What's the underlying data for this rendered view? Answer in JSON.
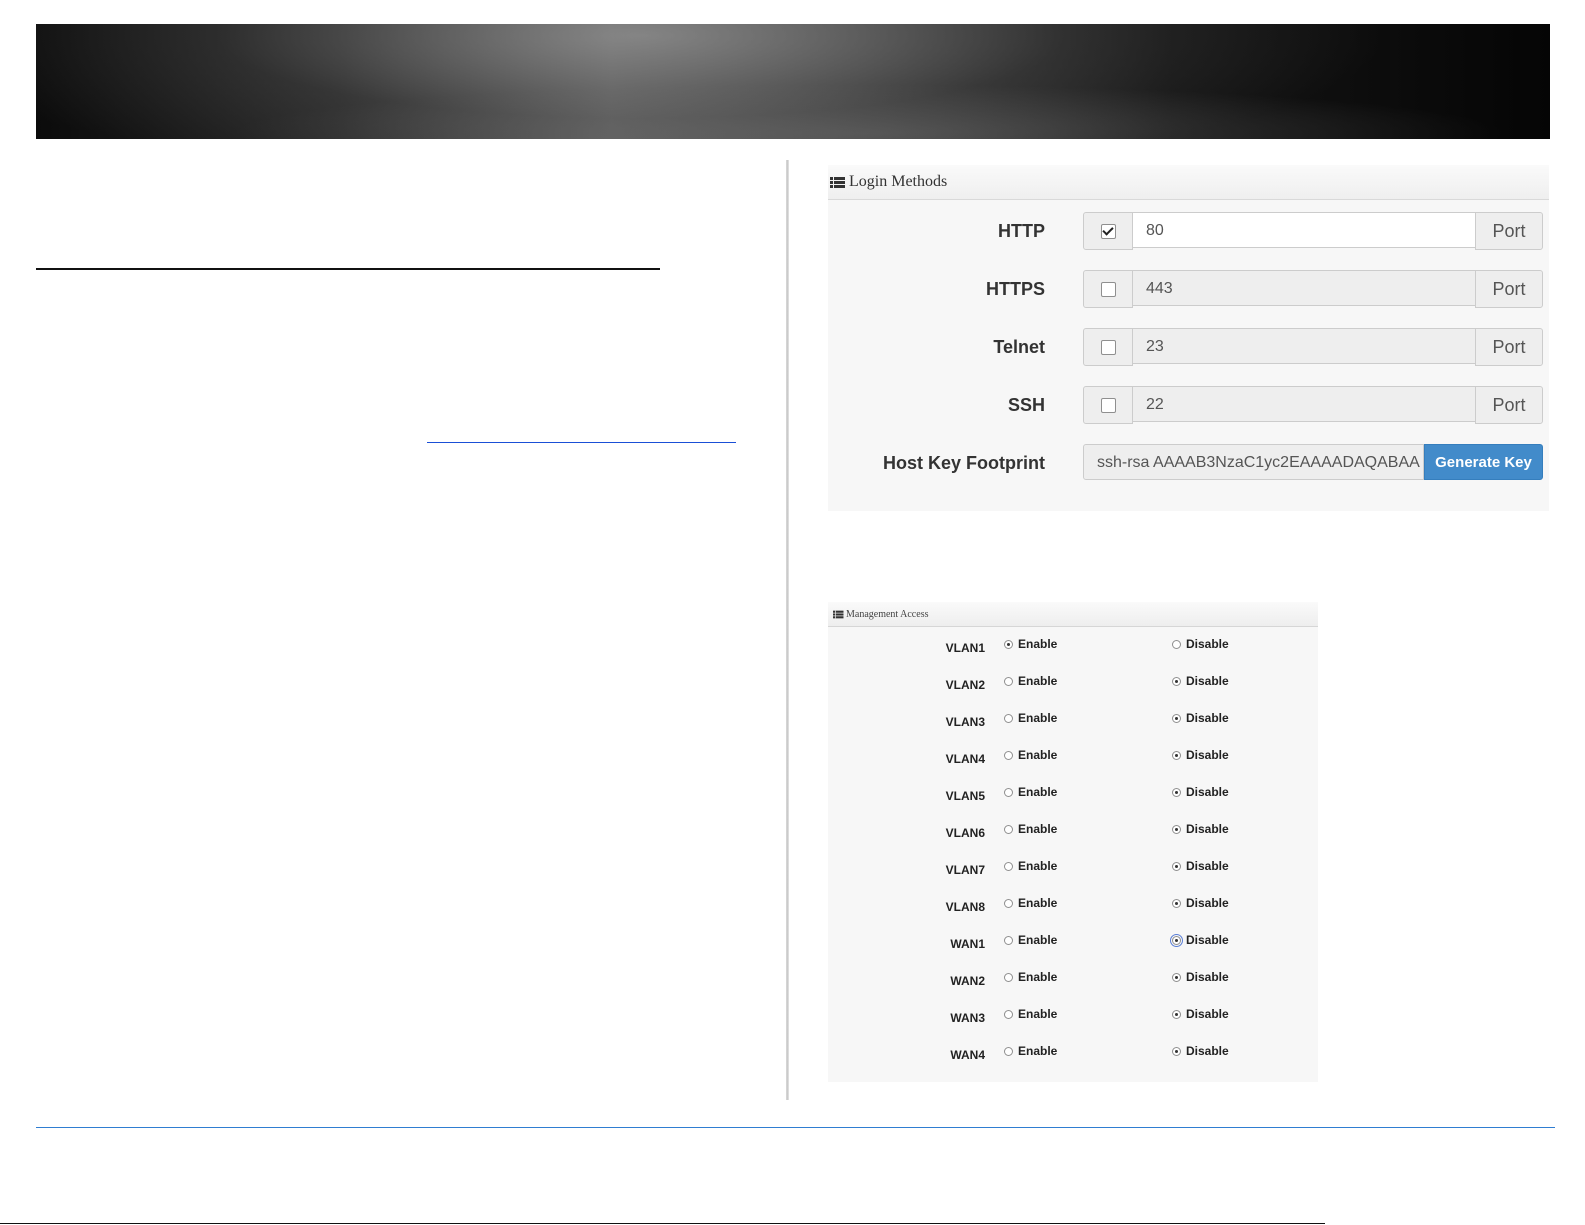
{
  "login": {
    "title": "Login Methods",
    "rows": [
      {
        "label": "HTTP",
        "checked": true,
        "value": "80",
        "addon": "Port"
      },
      {
        "label": "HTTPS",
        "checked": false,
        "value": "443",
        "addon": "Port"
      },
      {
        "label": "Telnet",
        "checked": false,
        "value": "23",
        "addon": "Port"
      },
      {
        "label": "SSH",
        "checked": false,
        "value": "22",
        "addon": "Port"
      }
    ],
    "hostkey": {
      "label": "Host Key Footprint",
      "value": "ssh-rsa AAAAB3NzaC1yc2EAAAADAQABAA",
      "button": "Generate Key"
    }
  },
  "mgmt": {
    "title": "Management Access",
    "enable_label": "Enable",
    "disable_label": "Disable",
    "rows": [
      {
        "label": "VLAN1",
        "selected": "enable"
      },
      {
        "label": "VLAN2",
        "selected": "disable"
      },
      {
        "label": "VLAN3",
        "selected": "disable"
      },
      {
        "label": "VLAN4",
        "selected": "disable"
      },
      {
        "label": "VLAN5",
        "selected": "disable"
      },
      {
        "label": "VLAN6",
        "selected": "disable"
      },
      {
        "label": "VLAN7",
        "selected": "disable"
      },
      {
        "label": "VLAN8",
        "selected": "disable"
      },
      {
        "label": "WAN1",
        "selected": "disable"
      },
      {
        "label": "WAN2",
        "selected": "disable"
      },
      {
        "label": "WAN3",
        "selected": "disable"
      },
      {
        "label": "WAN4",
        "selected": "disable"
      }
    ]
  },
  "colors": {
    "button_primary": "#428bca",
    "footer_rule": "#2f7dd1",
    "link_underline": "#1a4fd6"
  }
}
